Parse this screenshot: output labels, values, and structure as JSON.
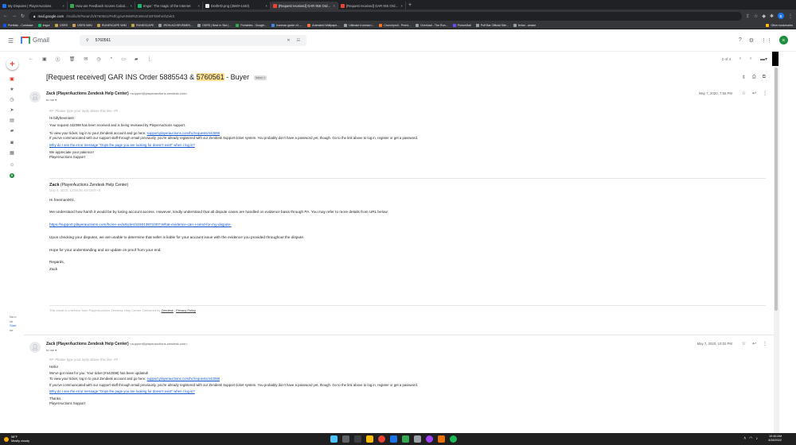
{
  "browser": {
    "tabs": [
      {
        "title": "My Disputes | PlayerAuctions",
        "color": "#1a73e8",
        "active": false
      },
      {
        "title": "How are Feedback Scores Calcul...",
        "color": "#34a853",
        "active": false
      },
      {
        "title": "Imgur: The magic of the Internet",
        "color": "#1bb76e",
        "active": false
      },
      {
        "title": "DraftrrD.png (2560×1440)",
        "color": "#e8eaed",
        "active": false
      },
      {
        "title": "[Request received] GAR INS Ord...",
        "color": "#ea4335",
        "active": true
      },
      {
        "title": "[Request received] GAR INS Ord...",
        "color": "#ea4335",
        "active": false
      }
    ],
    "new_tab": "+",
    "url_prefix": "mail.google.com",
    "url_rest": "/mail/u/0/#search/5760561/FMfcgzwHNWRZnWnmhDFkWhmhZvkX",
    "profile_letter": "B",
    "bookmarks": [
      "Portfolio - Coinbase",
      "Imgur",
      "OSRS",
      "OSRS WIKI",
      "RUNESCAPE WIKI",
      "RUNESCAPE",
      "IRON ACHIEVEMEN...",
      "OSRS | Best in Slot |...",
      "Portables - Google...",
      "Ironman guide v3 -...",
      "Animated Wallpape...",
      "Ultimate Ironman i...",
      "Crunchyroll - Premi...",
      "Overload - The Run...",
      "ProtonMail",
      "Puff Bar Official Site...",
      "ferian - avatar"
    ],
    "other_bookmarks": "Other bookmarks"
  },
  "gmail": {
    "logo_text": "Gmail",
    "search_value": "5760561",
    "pager": "2 of 4",
    "profile_letter": "B"
  },
  "thread": {
    "subject_pre": "[Request received] GAR INS Order 5885543 & ",
    "subject_hl": "5760561",
    "subject_post": " - Buyer",
    "label": "Inbox ×"
  },
  "message1": {
    "sender_name": "Zack (PlayerAuctions Zendesk Help Center)",
    "sender_email": "<support@playerauctions.zendesk.com>",
    "to": "to me ▾",
    "date": "May 7, 2020, 7:56 PM",
    "reply_line": "##- Please type your reply above this line -##",
    "greeting": "Hi billyfreeman0",
    "line1": "Your request 442098 has been received and is being reviewed by PlayerAuctions support.",
    "line2_pre": "To view your ticket, log in to your Zendesk account and go here: ",
    "line2_link": "support.playerauctions.com/hc/requests/442098",
    "line3": "If you've communicated with our support staff through email previously, you're already registered with our Zendesk Support ticket system. You probably don't have a password yet, though. Go to the link above to log in, register or get a password.",
    "line4_link": "Why do I see the error message \"Oops the page you are looking for doesn't exist\" when I log in?",
    "sign1": "We appreciate your patience!",
    "sign2": "PlayerAuctions Support"
  },
  "message2": {
    "name": "Zack",
    "name_rest": " (PlayerAuctions Zendesk Help Center)",
    "date_sub": "May 8, 2020, 12:58:28 AM GMT+8",
    "greeting": "Hi freeman001,",
    "p1": "We understand how harsh it would be by losing account access. However, kindly understand that all dispute cases are handled on evidence basis through PA. You may refer to more details from URL below:",
    "link": "https://support.playerauctions.com/hc/en-us/articles/115013871007-What-evidence-can-I-send-for-my-dispute-",
    "p2": "Upon checking your disputes, we are unable to determine that seller is liable for your account issue with the evidence you provided throughout the dispute.",
    "p3": "Hope for your understanding and an update on proof from your end.",
    "regards": "Regards,",
    "sig": "Zack",
    "footer_pre": "This email is a service from PlayerAuctions Zendesk Help Center. Delivered by ",
    "footer_zd": "Zendesk",
    "footer_sep": " | ",
    "footer_pp": "Privacy Policy"
  },
  "message3": {
    "sender_name": "Zack (PlayerAuctions Zendesk Help Center)",
    "sender_email": "<support@playerauctions.zendesk.com>",
    "to": "to me ▾",
    "date": "May 7, 2020, 10:02 PM",
    "reply_line": "##- Please type your reply above this line -##",
    "greeting": "Hello!",
    "line1": "We've got news for you: Your ticket (#442098) has been updated!",
    "line2_pre": "To view your ticket, log in to your Zendesk account and go here: ",
    "line2_link": "support.playerauctions.com/hc/requests/442098",
    "line3": "If you've communicated with our support staff through email previously, you're already registered with our Zendesk Support ticket system. You probably don't have a password yet, though. Go to the link above to log in, register or get a password.",
    "line4_link": "Why do I see the error message \"Oops the page you are looking for doesn't exist\" when I log in?",
    "sign1": "Thanks,",
    "sign2": "PlayerAuctions Support"
  },
  "side": {
    "line1": "No n",
    "line2": "ch",
    "line3": "Start",
    "line4": "ne"
  },
  "taskbar": {
    "temp": "58°F",
    "cond": "Mostly cloudy",
    "time": "10:46 AM",
    "date": "4/28/2022"
  }
}
